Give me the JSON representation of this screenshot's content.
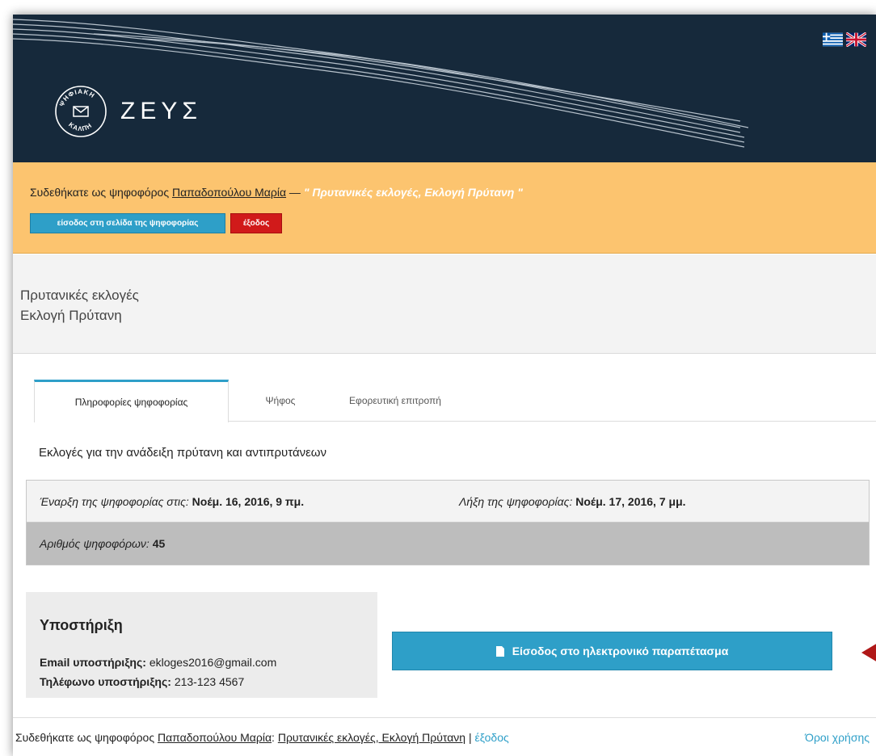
{
  "header": {
    "brand": "ΖΕΥΣ",
    "logo_text": "ΨΗΦΙΑΚΗ ΚΑΛΠΗ",
    "languages": [
      "greek-flag-icon",
      "uk-flag-icon"
    ]
  },
  "notice": {
    "prefix": "Συδεθήκατε ως ψηφοφόρος",
    "voter_name": "Παπαδοπούλου Μαρία",
    "dash": " — ",
    "election": "\" Πρυτανικές εκλογές, Εκλογή Πρύτανη \"",
    "enter_button": "είσοδος στη σελίδα της ψηφοφορίας",
    "exit_button": "έξοδος"
  },
  "title": {
    "line1": "Πρυτανικές εκλογές",
    "line2": "Εκλογή Πρύτανη"
  },
  "tabs": [
    {
      "label": "Πληροφορίες ψηφοφορίας",
      "active": true
    },
    {
      "label": "Ψήφος",
      "active": false
    },
    {
      "label": "Εφορευτική επιτροπή",
      "active": false
    }
  ],
  "description": "Εκλογές για την ανάδειξη πρύτανη και αντιπρυτάνεων",
  "info": {
    "start_label": "Έναρξη της ψηφοφορίας στις:",
    "start_value": "Νοέμ. 16, 2016, 9 πμ.",
    "end_label": "Λήξη της ψηφοφορίας:",
    "end_value": "Νοέμ. 17, 2016, 7 μμ.",
    "voters_label": "Αριθμός ψηφοφόρων:",
    "voters_value": "45"
  },
  "support": {
    "title": "Υποστήριξη",
    "email_label": "Email υποστήριξης:",
    "email_value": "ekloges2016@gmail.com",
    "phone_label": "Τηλέφωνο υποστήριξης:",
    "phone_value": "213-123 4567"
  },
  "booth_button": "Είσοδος στο ηλεκτρονικό παραπέτασμα",
  "footer": {
    "prefix": "Συδεθήκατε ως ψηφοφόρος",
    "voter_name": "Παπαδοπούλου Μαρία",
    "colon": ": ",
    "election": "Πρυτανικές εκλογές, Εκλογή Πρύτανη",
    "sep": " | ",
    "exit": "έξοδος",
    "terms": "Όροι χρήσης"
  },
  "colors": {
    "header_bg": "#16293b",
    "notice_bg": "#fcc46f",
    "accent": "#2e9fc8",
    "danger": "#d11a1a",
    "arrow": "#b01818"
  }
}
